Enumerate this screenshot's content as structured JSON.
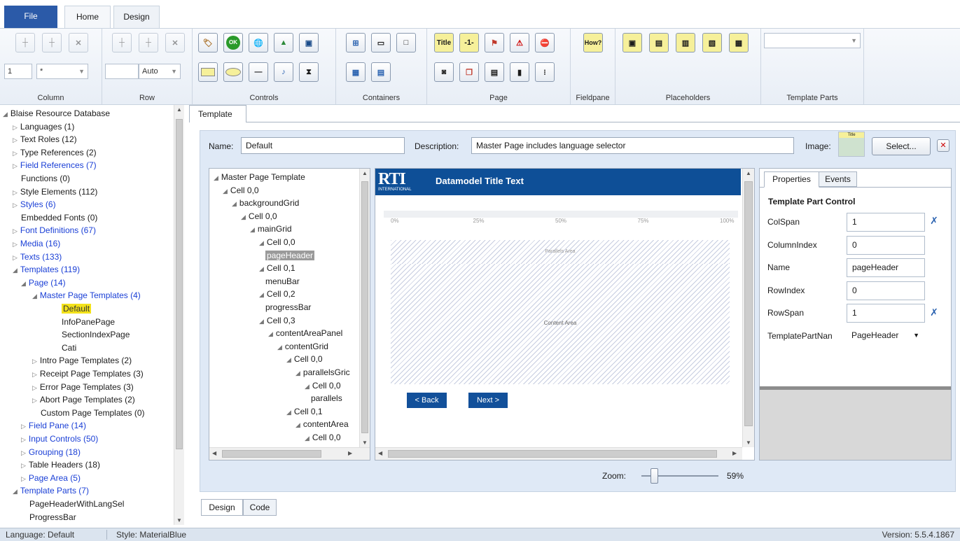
{
  "heading_fragment": "p",
  "heading_fragment2": "g",
  "tabs": {
    "file": "File",
    "home": "Home",
    "design": "Design"
  },
  "ribbon": {
    "column": {
      "label": "Column",
      "value1": "1",
      "value2": "*"
    },
    "row": {
      "label": "Row",
      "value1": "",
      "value2": "Auto"
    },
    "controls": {
      "label": "Controls"
    },
    "containers": {
      "label": "Containers"
    },
    "page": {
      "label": "Page",
      "title_btn": "Title",
      "num_btn": "-1-"
    },
    "fieldpane": {
      "label": "Fieldpane",
      "how_btn": "How?"
    },
    "placeholders": {
      "label": "Placeholders"
    },
    "template_parts": {
      "label": "Template Parts",
      "combo_value": ""
    }
  },
  "resource_tree": [
    {
      "label": "Blaise Resource Database",
      "level": 0,
      "expanded": true,
      "blue": false
    },
    {
      "label": "Languages (1)",
      "level": 1,
      "collapsed": true,
      "blue": false
    },
    {
      "label": "Text Roles (12)",
      "level": 1,
      "collapsed": true,
      "blue": false
    },
    {
      "label": "Type References (2)",
      "level": 1,
      "collapsed": true,
      "blue": false
    },
    {
      "label": "Field References (7)",
      "level": 1,
      "collapsed": true,
      "blue": true
    },
    {
      "label": "Functions (0)",
      "level": 1,
      "blue": false
    },
    {
      "label": "Style Elements (112)",
      "level": 1,
      "collapsed": true,
      "blue": false
    },
    {
      "label": "Styles (6)",
      "level": 1,
      "collapsed": true,
      "blue": true
    },
    {
      "label": "Embedded Fonts (0)",
      "level": 1,
      "blue": false
    },
    {
      "label": "Font Definitions (67)",
      "level": 1,
      "collapsed": true,
      "blue": true
    },
    {
      "label": "Media (16)",
      "level": 1,
      "collapsed": true,
      "blue": true
    },
    {
      "label": "Texts (133)",
      "level": 1,
      "collapsed": true,
      "blue": true
    },
    {
      "label": "Templates (119)",
      "level": 1,
      "expanded": true,
      "blue": true
    },
    {
      "label": "Page (14)",
      "level": 2,
      "expanded": true,
      "blue": true
    },
    {
      "label": "Master Page Templates (4)",
      "level": 3,
      "expanded": true,
      "blue": true
    },
    {
      "label": "Default",
      "level": 4,
      "selected": true,
      "blue": false
    },
    {
      "label": "InfoPanePage",
      "level": 4,
      "blue": false
    },
    {
      "label": "SectionIndexPage",
      "level": 4,
      "blue": false
    },
    {
      "label": "Cati",
      "level": 4,
      "blue": false
    },
    {
      "label": "Intro Page Templates (2)",
      "level": 3,
      "collapsed": true,
      "blue": false
    },
    {
      "label": "Receipt Page Templates (3)",
      "level": 3,
      "collapsed": true,
      "blue": false
    },
    {
      "label": "Error Page Templates (3)",
      "level": 3,
      "collapsed": true,
      "blue": false
    },
    {
      "label": "Abort Page Templates (2)",
      "level": 3,
      "collapsed": true,
      "blue": false
    },
    {
      "label": "Custom Page Templates (0)",
      "level": 3,
      "blue": false
    },
    {
      "label": "Field Pane (14)",
      "level": 2,
      "collapsed": true,
      "blue": true
    },
    {
      "label": "Input Controls (50)",
      "level": 2,
      "collapsed": true,
      "blue": true
    },
    {
      "label": "Grouping (18)",
      "level": 2,
      "collapsed": true,
      "blue": true
    },
    {
      "label": "Table Headers (18)",
      "level": 2,
      "collapsed": true,
      "blue": false
    },
    {
      "label": "Page Area (5)",
      "level": 2,
      "collapsed": true,
      "blue": true
    },
    {
      "label": "Template Parts (7)",
      "level": 1,
      "expanded": true,
      "blue": true
    },
    {
      "label": "PageHeaderWithLangSel",
      "level": 2,
      "blue": false
    },
    {
      "label": "ProgressBar",
      "level": 2,
      "blue": false
    }
  ],
  "doc_tab": "Template",
  "form": {
    "name_label": "Name:",
    "name_value": "Default",
    "desc_label": "Description:",
    "desc_value": "Master Page includes language selector",
    "image_label": "Image:",
    "select_btn": "Select...",
    "image_thumb_text": "Title"
  },
  "template_tree": [
    {
      "label": "Master Page Template",
      "level": 0
    },
    {
      "label": "Cell 0,0",
      "level": 1
    },
    {
      "label": "backgroundGrid",
      "level": 2
    },
    {
      "label": "Cell 0,0",
      "level": 3
    },
    {
      "label": "mainGrid",
      "level": 4
    },
    {
      "label": "Cell 0,0",
      "level": 5
    },
    {
      "label": "pageHeader",
      "level": 6,
      "selected": true,
      "leaf": true
    },
    {
      "label": "Cell 0,1",
      "level": 5
    },
    {
      "label": "menuBar",
      "level": 6,
      "leaf": true
    },
    {
      "label": "Cell 0,2",
      "level": 5
    },
    {
      "label": "progressBar",
      "level": 6,
      "leaf": true
    },
    {
      "label": "Cell 0,3",
      "level": 5
    },
    {
      "label": "contentAreaPanel",
      "level": 6
    },
    {
      "label": "contentGrid",
      "level": 7
    },
    {
      "label": "Cell 0,0",
      "level": 8
    },
    {
      "label": "parallelsGric",
      "level": 9
    },
    {
      "label": "Cell 0,0",
      "level": 10
    },
    {
      "label": "parallels",
      "level": 11,
      "leaf": true
    },
    {
      "label": "Cell 0,1",
      "level": 8
    },
    {
      "label": "contentArea",
      "level": 9
    },
    {
      "label": "Cell 0,0",
      "level": 10
    }
  ],
  "canvas": {
    "logo": "RTI",
    "logo_sub": "INTERNATIONAL",
    "title": "Datamodel Title Text",
    "progress_ticks": [
      "0%",
      "25%",
      "50%",
      "75%",
      "100%"
    ],
    "parallels_label": "Parallels Area",
    "content_label": "Content Area",
    "back_btn": "< Back",
    "next_btn": "Next >"
  },
  "properties": {
    "tab_properties": "Properties",
    "tab_events": "Events",
    "heading": "Template Part Control",
    "rows": [
      {
        "name": "ColSpan",
        "value": "1"
      },
      {
        "name": "ColumnIndex",
        "value": "0"
      },
      {
        "name": "Name",
        "value": "pageHeader"
      },
      {
        "name": "RowIndex",
        "value": "0"
      },
      {
        "name": "RowSpan",
        "value": "1"
      },
      {
        "name": "TemplatePartNan",
        "value": "PageHeader"
      }
    ]
  },
  "zoom": {
    "label": "Zoom:",
    "value": "59%",
    "level": 0.12
  },
  "bottom_tabs": {
    "design": "Design",
    "code": "Code"
  },
  "status": {
    "language": "Language: Default",
    "style": "Style: MaterialBlue",
    "version": "Version: 5.5.4.1867"
  },
  "colors": {
    "accent": "#2b5aa8",
    "selected": "#f3e21a",
    "header": "#0e4f97",
    "link": "#1a3fd6"
  }
}
